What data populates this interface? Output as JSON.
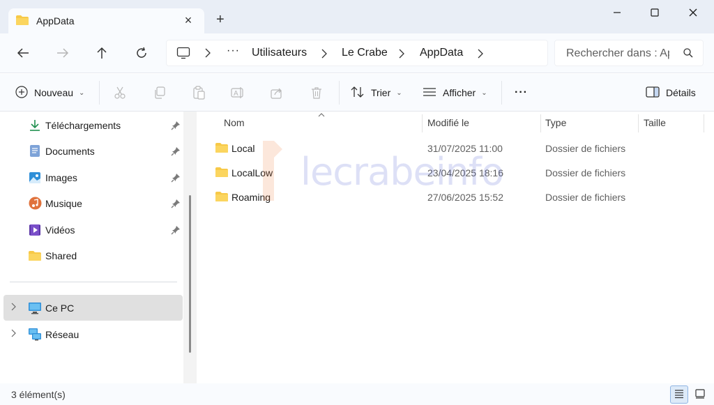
{
  "window": {
    "tab_title": "AppData",
    "new_tab_symbol": "+",
    "controls": [
      "minimize-icon",
      "maximize-icon",
      "close-icon"
    ]
  },
  "address": {
    "overflow": "···",
    "breadcrumbs": [
      "Utilisateurs",
      "Le Crabe",
      "AppData"
    ],
    "search_placeholder": "Rechercher dans : AppData"
  },
  "commands": {
    "new_label": "Nouveau",
    "sort_label": "Trier",
    "view_label": "Afficher",
    "more": "···",
    "details_label": "Détails",
    "dimmed_icons": [
      "cut-icon",
      "copy-icon",
      "paste-icon",
      "rename-icon",
      "share-icon",
      "delete-icon"
    ]
  },
  "sidebar": {
    "quick_access": [
      {
        "label": "Téléchargements",
        "icon": "download-icon",
        "pinned": true
      },
      {
        "label": "Documents",
        "icon": "documents-icon",
        "pinned": true
      },
      {
        "label": "Images",
        "icon": "images-icon",
        "pinned": true
      },
      {
        "label": "Musique",
        "icon": "music-icon",
        "pinned": true
      },
      {
        "label": "Vidéos",
        "icon": "videos-icon",
        "pinned": true
      },
      {
        "label": "Shared",
        "icon": "folder-icon",
        "pinned": false
      }
    ],
    "locations": [
      {
        "label": "Ce PC",
        "icon": "computer-icon",
        "selected": true
      },
      {
        "label": "Réseau",
        "icon": "network-icon",
        "selected": false
      }
    ]
  },
  "columns": {
    "name": "Nom",
    "modified": "Modifié le",
    "type": "Type",
    "size": "Taille"
  },
  "files": [
    {
      "name": "Local",
      "modified": "31/07/2025 11:00",
      "type": "Dossier de fichiers"
    },
    {
      "name": "LocalLow",
      "modified": "23/04/2025 18:16",
      "type": "Dossier de fichiers"
    },
    {
      "name": "Roaming",
      "modified": "27/06/2025 15:52",
      "type": "Dossier de fichiers"
    }
  ],
  "watermark": "lecrabeinfo",
  "status": {
    "count": "3 élément(s)"
  },
  "colors": {
    "folder": "#f7c948",
    "titlebar_bg": "#e9eef6",
    "selection": "#e0e0e0",
    "accent": "#0067c0"
  }
}
